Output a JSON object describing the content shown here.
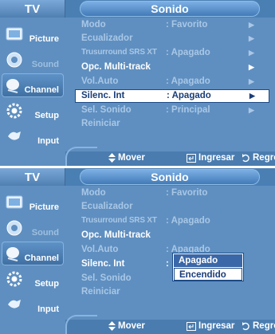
{
  "panels": [
    {
      "header": {
        "tv": "TV",
        "title": "Sonido"
      },
      "tabs": [
        {
          "label": "Picture",
          "icon": "picture-icon"
        },
        {
          "label": "Sound",
          "icon": "sound-icon"
        },
        {
          "label": "Channel",
          "icon": "channel-icon"
        },
        {
          "label": "Setup",
          "icon": "setup-icon"
        },
        {
          "label": "Input",
          "icon": "input-icon"
        }
      ],
      "menu": [
        {
          "label": "Modo",
          "value": ": Favorito",
          "arrow": "▶"
        },
        {
          "label": "Ecualizador",
          "value": "",
          "arrow": "▶"
        },
        {
          "label": "Trusurround SRS XT",
          "value": ": Apagado",
          "arrow": "▶"
        },
        {
          "label": "Opc. Multi-track",
          "value": "",
          "arrow": "▶"
        },
        {
          "label": "Vol.Auto",
          "value": ": Apagado",
          "arrow": "▶"
        },
        {
          "label": "Silenc. Int",
          "value": ": Apagado",
          "arrow": "▶"
        },
        {
          "label": "Sel. Sonido",
          "value": ": Principal",
          "arrow": "▶"
        },
        {
          "label": "Reiniciar",
          "value": "",
          "arrow": ""
        }
      ],
      "footer": {
        "move": "Mover",
        "enter": "Ingresar",
        "return": "Regresar"
      }
    },
    {
      "header": {
        "tv": "TV",
        "title": "Sonido"
      },
      "tabs": [
        {
          "label": "Picture",
          "icon": "picture-icon"
        },
        {
          "label": "Sound",
          "icon": "sound-icon"
        },
        {
          "label": "Channel",
          "icon": "channel-icon"
        },
        {
          "label": "Setup",
          "icon": "setup-icon"
        },
        {
          "label": "Input",
          "icon": "input-icon"
        }
      ],
      "menu": [
        {
          "label": "Modo",
          "value": ": Favorito"
        },
        {
          "label": "Ecualizador",
          "value": ""
        },
        {
          "label": "Trusurround SRS XT",
          "value": ": Apagado"
        },
        {
          "label": "Opc. Multi-track",
          "value": ""
        },
        {
          "label": "Vol.Auto",
          "value": ": Apagado"
        },
        {
          "label": "Silenc. Int",
          "value": ":"
        },
        {
          "label": "Sel. Sonido",
          "value": ""
        },
        {
          "label": "Reiniciar",
          "value": ""
        }
      ],
      "dropdown": [
        "Apagado",
        "Encendido"
      ],
      "footer": {
        "move": "Mover",
        "enter": "Ingresar",
        "return": "Regresar"
      }
    }
  ],
  "colors": {
    "panel_bg": "#5f8fc0",
    "header_bar": "#4a7fb4",
    "highlight_bg": "#ffffff",
    "highlight_text": "#1a3d78",
    "dim_text": "#a9c7e6"
  }
}
